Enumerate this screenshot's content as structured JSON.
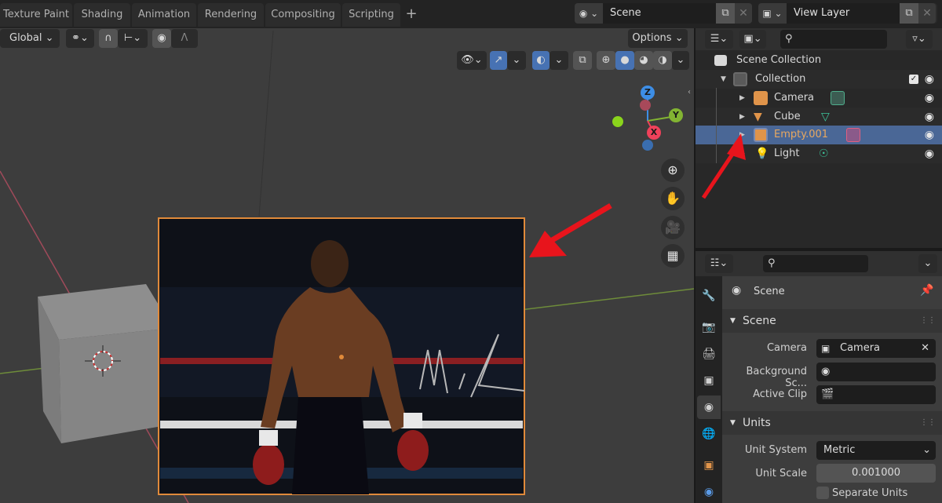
{
  "workspace_tabs": [
    "Texture Paint",
    "Shading",
    "Animation",
    "Rendering",
    "Compositing",
    "Scripting"
  ],
  "add_workspace_label": "+",
  "scene_selector": {
    "value": "Scene",
    "icon": "scene-icon"
  },
  "view_layer_selector": {
    "value": "View Layer",
    "icon": "view-layer-icon"
  },
  "viewport_header": {
    "transform_orientation": "Global",
    "options_label": "Options"
  },
  "navigation_gizmo": {
    "axes": [
      "X",
      "Y",
      "Z"
    ],
    "colors": {
      "x": "#f0415a",
      "y": "#82b432",
      "z": "#3d8ee6",
      "neg_x": "#a8495a",
      "neg_y": "#8ad41c",
      "neg_z": "#3a6eb0"
    }
  },
  "outliner": {
    "search_placeholder": "",
    "rows": [
      {
        "label": "Scene Collection",
        "icon": "scene-collection-icon",
        "level": 0
      },
      {
        "label": "Collection",
        "icon": "collection-icon",
        "level": 1,
        "checked": true,
        "expanded": true
      },
      {
        "label": "Camera",
        "icon": "camera-object-icon",
        "data_icon": "camera-data-icon",
        "level": 2
      },
      {
        "label": "Cube",
        "icon": "mesh-object-icon",
        "data_icon": "mesh-data-icon",
        "level": 2
      },
      {
        "label": "Empty.001",
        "icon": "image-empty-icon",
        "data_icon": "image-data-icon",
        "level": 2,
        "selected": true
      },
      {
        "label": "Light",
        "icon": "light-object-icon",
        "data_icon": "light-data-icon",
        "level": 2
      }
    ]
  },
  "properties": {
    "search_placeholder": "",
    "context_title": "Scene",
    "panels": {
      "scene": {
        "title": "Scene",
        "camera_label": "Camera",
        "camera_value": "Camera",
        "background_label": "Background Sc...",
        "background_value": "",
        "active_clip_label": "Active Clip",
        "active_clip_value": ""
      },
      "units": {
        "title": "Units",
        "unit_system_label": "Unit System",
        "unit_system_value": "Metric",
        "unit_scale_label": "Unit Scale",
        "unit_scale_value": "0.001000",
        "separate_units_label": "Separate Units",
        "separate_units_checked": false
      }
    }
  },
  "colors": {
    "accent_blue": "#4772b3",
    "selection_outline": "#e08a3a",
    "selected_row": "#4a6796",
    "annotation_arrow": "#e8141c"
  }
}
